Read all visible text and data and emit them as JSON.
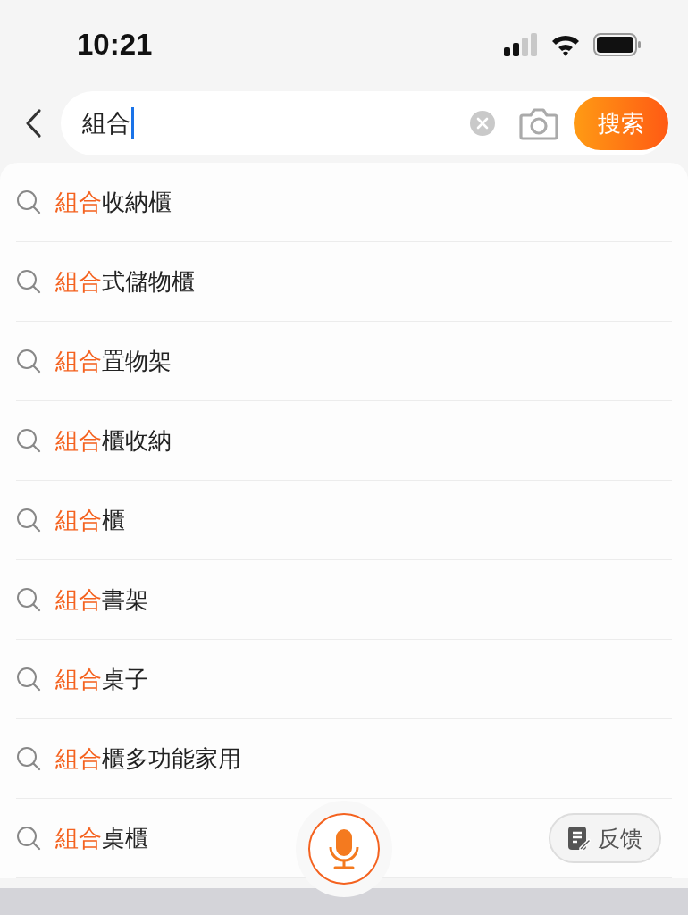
{
  "status_bar": {
    "time": "10:21"
  },
  "search": {
    "value": "組合",
    "button": "搜索"
  },
  "suggestions": [
    {
      "match": "組合",
      "rest": "收納櫃"
    },
    {
      "match": "組合",
      "rest": "式儲物櫃"
    },
    {
      "match": "組合",
      "rest": "置物架"
    },
    {
      "match": "組合",
      "rest": "櫃收納"
    },
    {
      "match": "組合",
      "rest": "櫃"
    },
    {
      "match": "組合",
      "rest": "書架"
    },
    {
      "match": "組合",
      "rest": "桌子"
    },
    {
      "match": "組合",
      "rest": "櫃多功能家用"
    },
    {
      "match": "組合",
      "rest": "桌櫃"
    }
  ],
  "feedback": {
    "label": "反馈"
  }
}
